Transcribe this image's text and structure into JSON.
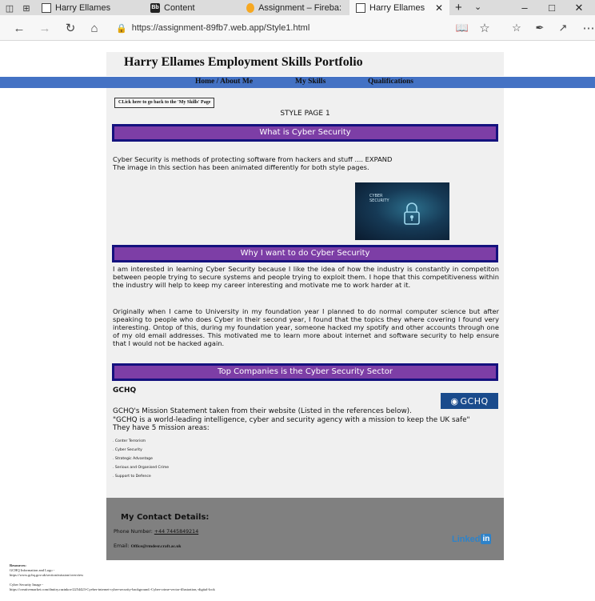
{
  "browser": {
    "ghost_title": "page",
    "tabs": [
      {
        "label": "Harry Ellames",
        "icon": "page-icon"
      },
      {
        "label": "Content",
        "icon": "blackboard-icon"
      },
      {
        "label": "Assignment – Fireba:",
        "icon": "firebase-icon"
      },
      {
        "label": "Harry Ellames",
        "icon": "page-icon",
        "active": true
      }
    ],
    "url": "https://assignment-89fb7.web.app/Style1.html"
  },
  "page": {
    "site_title": "Harry Ellames Employment Skills Portfolio",
    "menu": [
      "Home / About Me",
      "My Skills",
      "Qualifications"
    ],
    "back_button": "CLick here to go back to the 'My Skills' Page",
    "style_label": "STYLE PAGE 1",
    "sections": {
      "what": {
        "title": "What is Cyber Security",
        "lines": [
          "Cyber Security is methods of protecting software from hackers and stuff .... EXPAND",
          "The image in this section has been animated differently for both style pages."
        ]
      },
      "why": {
        "title": "Why I want to do Cyber Security",
        "para1": "I am interested in learning Cyber Security because I like the idea of how the industry is constantly in competiton between people trying to secure systems and people trying to exploit them. I hope that this competitiveness within the industry will help to keep my career interesting and motivate me to work harder at it.",
        "para2": "Originally when I came to University in my foundation year I planned to do normal computer science but after speaking to people who does Cyber in their second year, I found that the topics they where covering I found very interesting. Ontop of this, during my foundation year, someone hacked my spotify and other accounts through one of my old email addresses. This motivated me to learn more about internet and software security to help ensure that I would not be hacked again."
      },
      "companies": {
        "title": "Top Companies is the Cyber Security Sector",
        "company_name": "GCHQ",
        "logo_text": "GCHQ",
        "lines": [
          "GCHQ's Mission Statement taken from their website (Listed in the references below).",
          "\"GCHQ is a world-leading intelligence, cyber and security agency with a mission to keep the UK safe\"",
          "They have 5 mission areas:"
        ],
        "areas": [
          "Conter Terrorism",
          "Cyber Security",
          "Strategic Advantage",
          "Serious and Organised Crime",
          "Support to Defence"
        ]
      }
    },
    "image_text": [
      "CYBER",
      "SECURITY"
    ],
    "footer": {
      "title": "My Contact Details:",
      "phone_label": "Phone Number:",
      "phone": "+44 7445849214",
      "email_label": "Email:",
      "email": "Office@rmdesr.craft.ac.uk",
      "linkedin": "Linked",
      "linkedin_in": "in"
    },
    "resources": {
      "heading": "Resources:",
      "item1_label": "GCHQ Information and Logo -",
      "item1_url": "https://www.gchq.gov.uk/section/mission/overview",
      "item2_label": "Cyber Security Image -",
      "item2_url": "https://creativemarket.com/dmitry.razinkov/2254423-Cyeber-internet-cyber-security-background.-Cyber-crime-vector-illustration,-digital-lock"
    }
  }
}
